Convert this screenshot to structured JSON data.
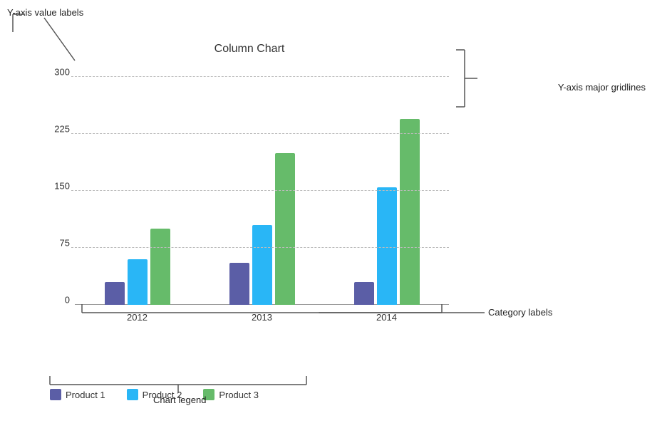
{
  "title": "Column Chart",
  "annotations": {
    "y_axis_label": "Y-axis value labels",
    "y_axis_gridlines": "Y-axis major gridlines",
    "category_labels": "Category labels",
    "chart_legend": "Chart legend"
  },
  "y_axis": {
    "max": 300,
    "labels": [
      "300",
      "225",
      "150",
      "75",
      "0"
    ]
  },
  "categories": [
    "2012",
    "2013",
    "2014"
  ],
  "legend": [
    {
      "label": "Product 1",
      "color": "#5b5ea6"
    },
    {
      "label": "Product 2",
      "color": "#29b6f6"
    },
    {
      "label": "Product 3",
      "color": "#66bb6a"
    }
  ],
  "series": {
    "product1": {
      "color": "#5b5ea6",
      "values": [
        30,
        55,
        30
      ]
    },
    "product2": {
      "color": "#29b6f6",
      "values": [
        60,
        105,
        155
      ]
    },
    "product3": {
      "color": "#66bb6a",
      "values": [
        100,
        200,
        245
      ]
    }
  },
  "chart_max": 300
}
